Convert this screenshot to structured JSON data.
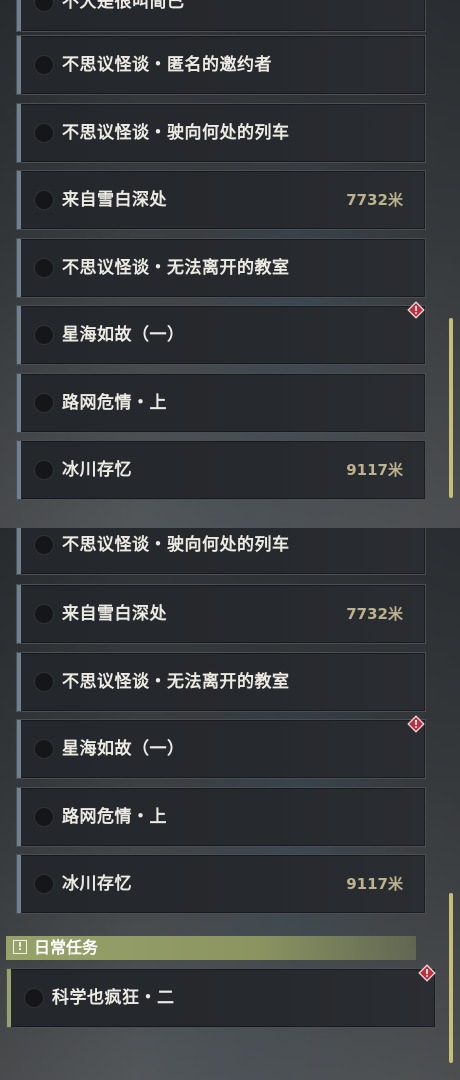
{
  "colors": {
    "accent_bar": "#6d8190",
    "daily_accent": "#96a46a",
    "distance": "#bcb28d",
    "alert": "#c0394a"
  },
  "panel1": {
    "partial_label": "不大是很叫简已",
    "quests": [
      {
        "label": "不思议怪谈・匿名的邀约者",
        "distance": ""
      },
      {
        "label": "不思议怪谈・驶向何处的列车",
        "distance": ""
      },
      {
        "label": "来自雪白深处",
        "distance": "7732米"
      },
      {
        "label": "不思议怪谈・无法离开的教室",
        "distance": ""
      },
      {
        "label": "星海如故（一）",
        "distance": "",
        "alert_icon": "alert-diamond-icon"
      },
      {
        "label": "路网危情・上",
        "distance": ""
      },
      {
        "label": "冰川存忆",
        "distance": "9117米"
      }
    ]
  },
  "panel2": {
    "quests": [
      {
        "label": "不思议怪谈・驶向何处的列车",
        "distance": ""
      },
      {
        "label": "来自雪白深处",
        "distance": "7732米"
      },
      {
        "label": "不思议怪谈・无法离开的教室",
        "distance": ""
      },
      {
        "label": "星海如故（一）",
        "distance": "",
        "alert_icon": "alert-diamond-icon"
      },
      {
        "label": "路网危情・上",
        "distance": ""
      },
      {
        "label": "冰川存忆",
        "distance": "9117米"
      }
    ],
    "daily_section": {
      "title": "日常任务",
      "icon": "exclamation-box-icon",
      "quests": [
        {
          "label": "科学也疯狂・二",
          "distance": "",
          "alert_icon": "alert-diamond-icon"
        }
      ]
    }
  }
}
